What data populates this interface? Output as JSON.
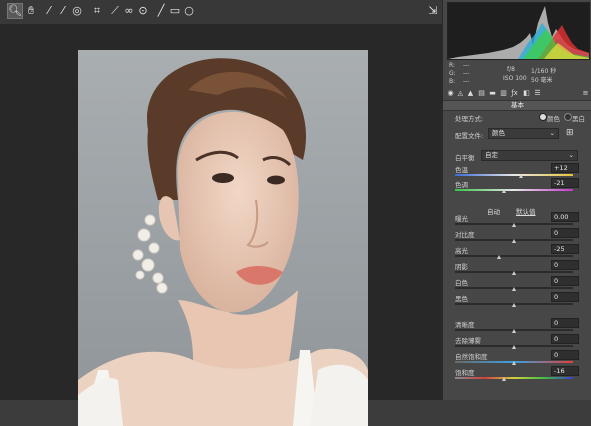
{
  "toolbar": {
    "tools": [
      {
        "icon": "zoom-icon",
        "glyph": "🔍︎"
      },
      {
        "icon": "hand-icon",
        "glyph": "✋︎"
      },
      {
        "icon": "white-balance-icon",
        "glyph": "⁄"
      },
      {
        "icon": "color-sampler-icon",
        "glyph": "⁄"
      },
      {
        "icon": "target-adjust-icon",
        "glyph": "◎"
      },
      {
        "icon": "crop-icon",
        "glyph": "⌗"
      },
      {
        "icon": "straighten-icon",
        "glyph": "⟋"
      },
      {
        "icon": "spot-removal-icon",
        "glyph": "∞"
      },
      {
        "icon": "red-eye-icon",
        "glyph": "⊙"
      },
      {
        "icon": "brush-icon",
        "glyph": "╱"
      },
      {
        "icon": "graduated-filter-icon",
        "glyph": "▭"
      },
      {
        "icon": "radial-filter-icon",
        "glyph": "○"
      }
    ],
    "right_icon": "open-image-icon"
  },
  "camera": {
    "r": "R:",
    "g": "G:",
    "b": "B:",
    "dashes": "---",
    "aperture": "f/8",
    "shutter": "1/160 秒",
    "iso": "ISO 100",
    "focal": "50 毫米"
  },
  "section_title": "基本",
  "treatment": {
    "label": "处理方式:",
    "opt1": "颜色",
    "opt2": "黑白"
  },
  "profile": {
    "label": "配置文件:",
    "value": "颜色"
  },
  "white_balance": {
    "label": "白平衡",
    "value": "自定"
  },
  "auto_label": "自动",
  "default_label": "默认值",
  "sliders": [
    {
      "label": "色温",
      "value": "+12",
      "pos": 0.56
    },
    {
      "label": "色调",
      "value": "-21",
      "pos": 0.42
    },
    {
      "label": "曝光",
      "value": "0.00",
      "pos": 0.5
    },
    {
      "label": "对比度",
      "value": "0",
      "pos": 0.5
    },
    {
      "label": "高光",
      "value": "-25",
      "pos": 0.38
    },
    {
      "label": "阴影",
      "value": "0",
      "pos": 0.5
    },
    {
      "label": "白色",
      "value": "0",
      "pos": 0.5
    },
    {
      "label": "黑色",
      "value": "0",
      "pos": 0.5
    },
    {
      "label": "清晰度",
      "value": "0",
      "pos": 0.5
    },
    {
      "label": "去除薄雾",
      "value": "0",
      "pos": 0.5
    },
    {
      "label": "自然饱和度",
      "value": "0",
      "pos": 0.5
    },
    {
      "label": "饱和度",
      "value": "-16",
      "pos": 0.42
    }
  ]
}
